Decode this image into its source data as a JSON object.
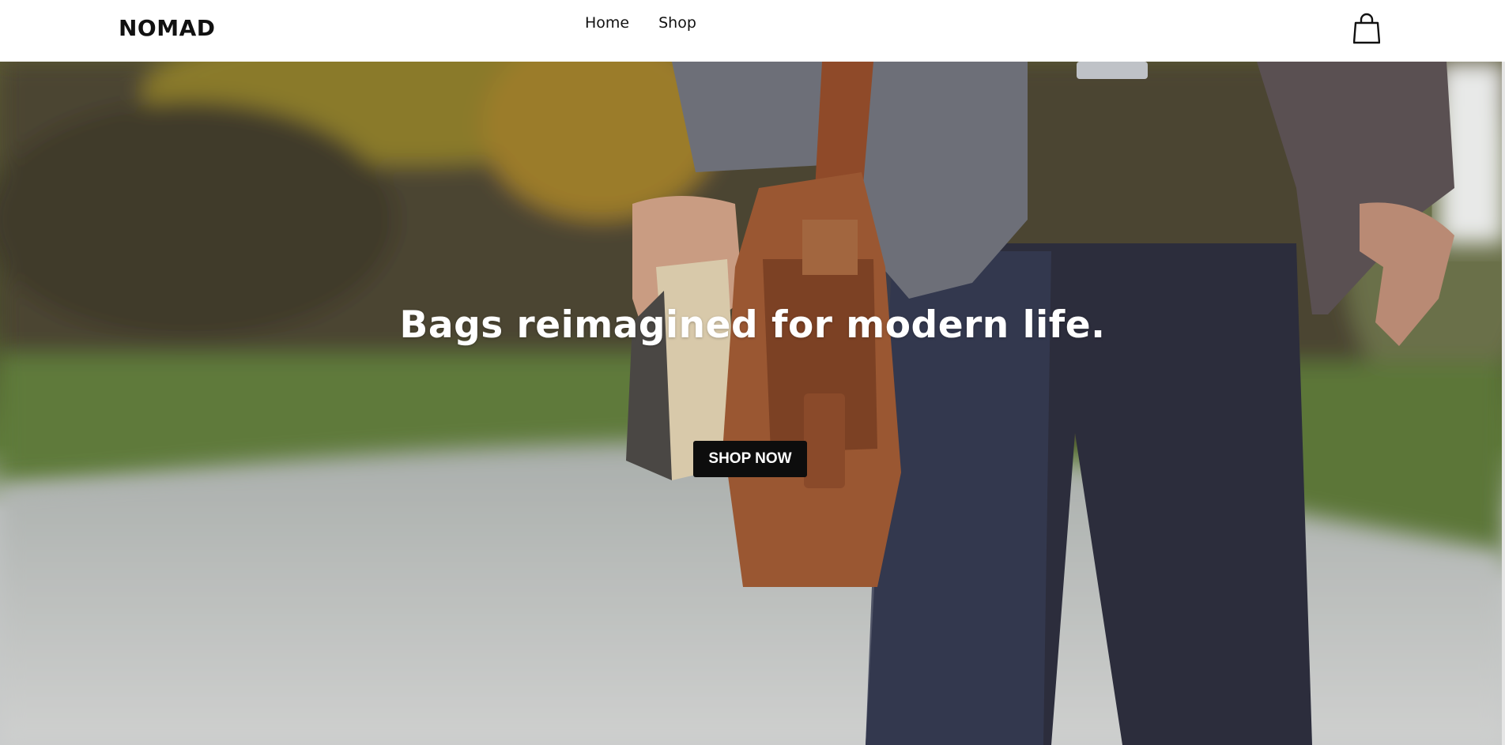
{
  "header": {
    "brand": "NOMAD",
    "nav": [
      "Home",
      "Shop"
    ],
    "cart_icon": "shopping-bag-icon"
  },
  "hero": {
    "headline": "Bags reimagined for modern life.",
    "cta_label": "SHOP NOW"
  },
  "colors": {
    "header_bg": "#ffffff",
    "button_bg": "#0d0d0d",
    "button_text": "#ffffff",
    "headline_text": "#ffffff"
  }
}
